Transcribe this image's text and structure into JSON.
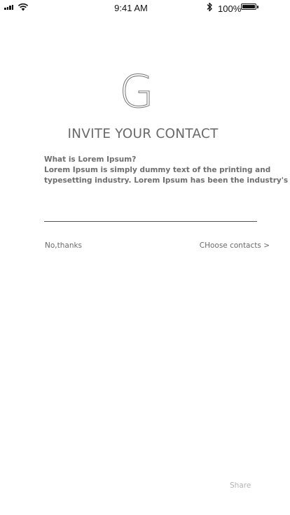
{
  "status_bar": {
    "time": "9:41 AM",
    "battery_percent": "100%"
  },
  "icons": {
    "signal": "signal-bars-icon",
    "wifi": "wifi-icon",
    "bluetooth": "bluetooth-icon",
    "battery": "battery-icon"
  },
  "logo": {
    "letter": "G"
  },
  "title": "INVITE YOUR CONTACT",
  "description": {
    "question": "What is Lorem Ipsum?",
    "line1": "Lorem Ipsum is simply dummy text of the printing and",
    "line2": "typesetting industry. Lorem Ipsum has been the industry's"
  },
  "input": {
    "value": "",
    "placeholder": ""
  },
  "actions": {
    "no_thanks": "No,thanks",
    "choose_contacts": "CHoose contacts >",
    "share": "Share"
  }
}
